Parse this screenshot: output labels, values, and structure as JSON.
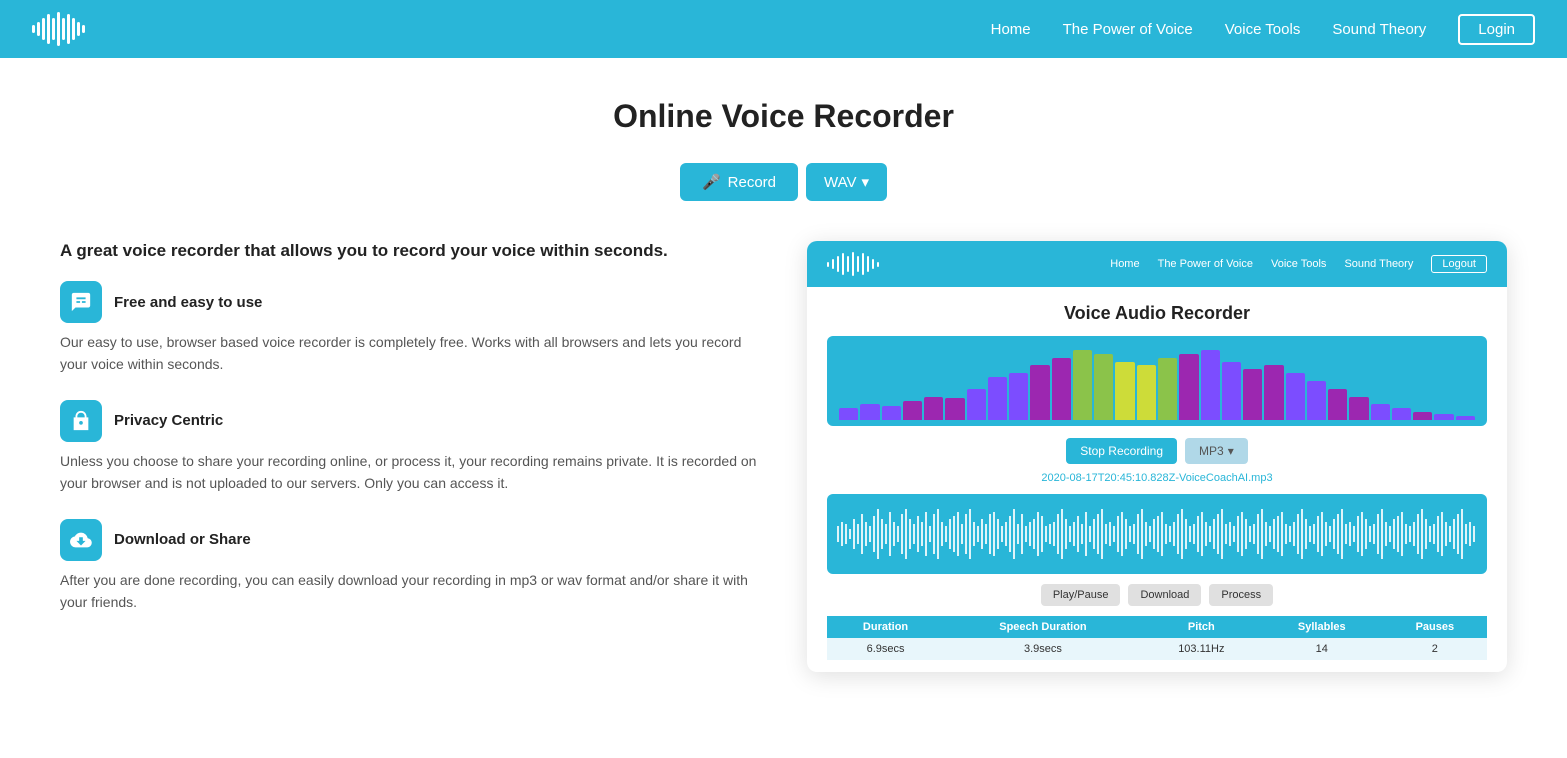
{
  "header": {
    "nav": {
      "home": "Home",
      "power_of_voice": "The Power of Voice",
      "voice_tools": "Voice Tools",
      "sound_theory": "Sound Theory",
      "login": "Login"
    }
  },
  "main": {
    "page_title": "Online Voice Recorder",
    "record_btn": "Record",
    "wav_btn": "WAV",
    "intro": "A great voice recorder that allows you to record your voice within seconds.",
    "features": [
      {
        "title": "Free and easy to use",
        "desc": "Our easy to use, browser based voice recorder is completely free. Works with all browsers and lets you record your voice within seconds."
      },
      {
        "title": "Privacy Centric",
        "desc": "Unless you choose to share your recording online, or process it, your recording remains private. It is recorded on your browser and is not uploaded to our servers. Only you can access it."
      },
      {
        "title": "Download or Share",
        "desc": "After you are done recording, you can easily download your recording in mp3 or wav format and/or share it with your friends."
      }
    ]
  },
  "widget": {
    "title": "Voice Audio Recorder",
    "nav": {
      "home": "Home",
      "power_of_voice": "The Power of Voice",
      "voice_tools": "Voice Tools",
      "sound_theory": "Sound Theory",
      "logout": "Logout"
    },
    "stop_btn": "Stop Recording",
    "mp3_btn": "MP3",
    "filename": "2020-08-17T20:45:10.828Z-VoiceCoachAI.mp3",
    "play_pause": "Play/Pause",
    "download": "Download",
    "process": "Process",
    "stats": {
      "headers": [
        "Duration",
        "Speech Duration",
        "Pitch",
        "Syllables",
        "Pauses"
      ],
      "values": [
        "6.9secs",
        "3.9secs",
        "103.11Hz",
        "14",
        "2"
      ]
    }
  }
}
